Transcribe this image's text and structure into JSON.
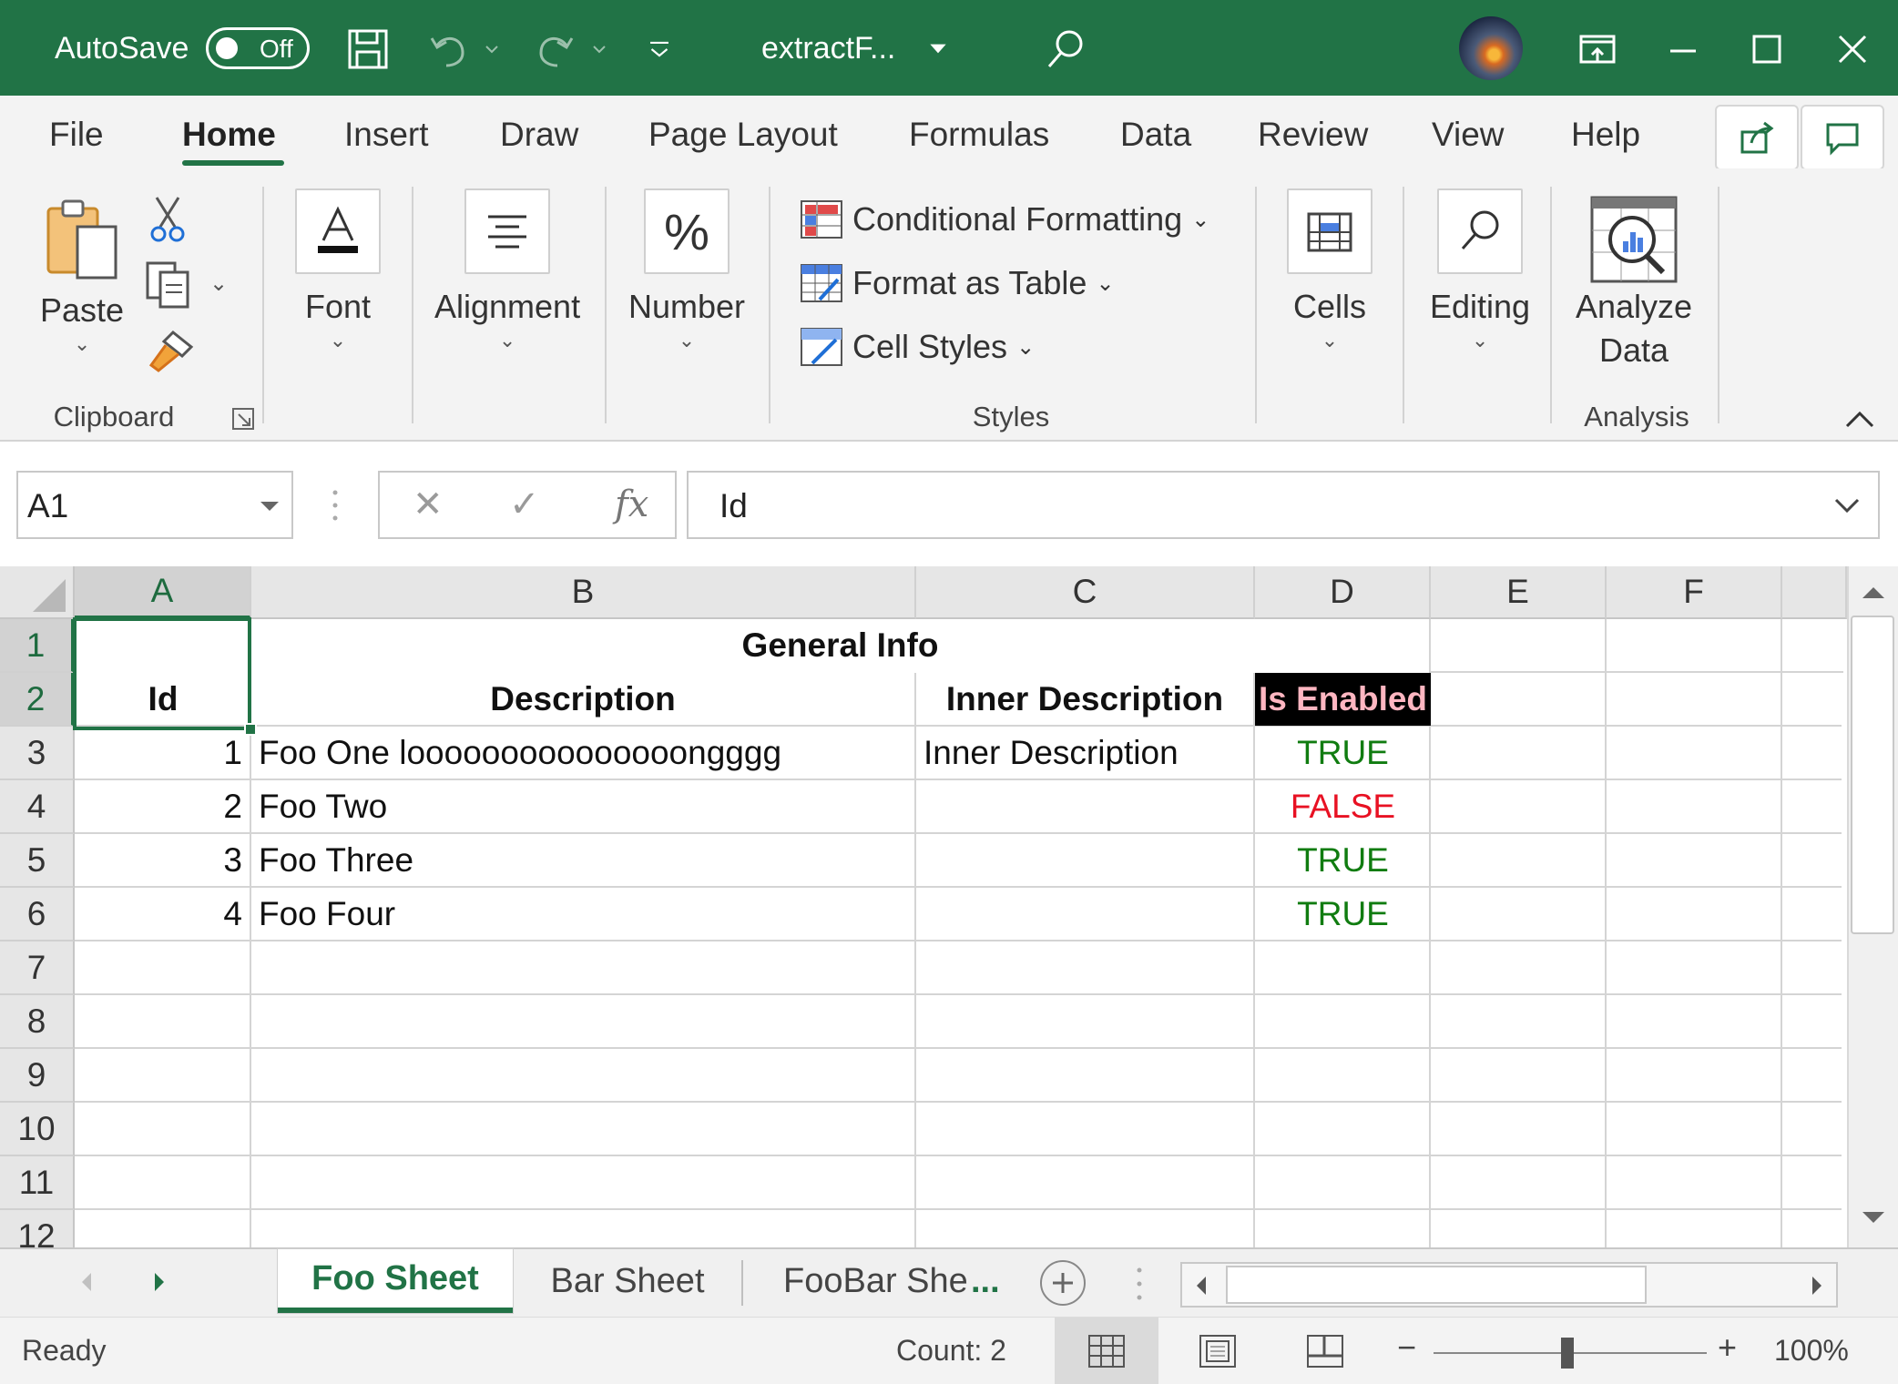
{
  "titlebar": {
    "autosave_label": "AutoSave",
    "autosave_state": "Off",
    "document_title": "extractF...",
    "icons": [
      "save-icon",
      "undo-icon",
      "redo-icon",
      "customize-qat-icon",
      "search-icon",
      "ribbon-display-icon",
      "minimize-icon",
      "maximize-icon",
      "close-icon"
    ]
  },
  "ribbon_tabs": [
    "File",
    "Home",
    "Insert",
    "Draw",
    "Page Layout",
    "Formulas",
    "Data",
    "Review",
    "View",
    "Help"
  ],
  "ribbon_active_tab": "Home",
  "ribbon": {
    "clipboard": {
      "paste": "Paste",
      "group": "Clipboard"
    },
    "font": {
      "label": "Font"
    },
    "alignment": {
      "label": "Alignment"
    },
    "number": {
      "label": "Number",
      "icon_glyph": "%"
    },
    "styles": {
      "conditional": "Conditional Formatting",
      "format_table": "Format as Table",
      "cell_styles": "Cell Styles",
      "group": "Styles"
    },
    "cells": {
      "label": "Cells"
    },
    "editing": {
      "label": "Editing"
    },
    "analysis": {
      "line1": "Analyze",
      "line2": "Data",
      "group": "Analysis"
    }
  },
  "formula_bar": {
    "name_box": "A1",
    "cancel_glyph": "✕",
    "enter_glyph": "✓",
    "fx_glyph": "fx",
    "content": "Id"
  },
  "columns": [
    "A",
    "B",
    "C",
    "D",
    "E",
    "F"
  ],
  "rows": [
    "1",
    "2",
    "3",
    "4",
    "5",
    "6",
    "7",
    "8",
    "9",
    "10",
    "11",
    "12"
  ],
  "sheet": {
    "merged_header": "General Info",
    "headers": {
      "id": "Id",
      "description": "Description",
      "inner": "Inner Description",
      "enabled": "Is Enabled"
    },
    "records": [
      {
        "id": "1",
        "description": "Foo One looooooooooooooongggg",
        "inner": "Inner Description",
        "enabled": "TRUE"
      },
      {
        "id": "2",
        "description": "Foo Two",
        "inner": "",
        "enabled": "FALSE"
      },
      {
        "id": "3",
        "description": "Foo Three",
        "inner": "",
        "enabled": "TRUE"
      },
      {
        "id": "4",
        "description": "Foo Four",
        "inner": "",
        "enabled": "TRUE"
      }
    ]
  },
  "colors": {
    "brand": "#217346",
    "true_text": "#107c10",
    "false_text": "#e81123",
    "enabled_header_bg": "#000000",
    "enabled_header_text": "#ffb6c1"
  },
  "sheet_tabs": [
    "Foo Sheet",
    "Bar Sheet",
    "FooBar She"
  ],
  "active_sheet": "Foo Sheet",
  "sheet_tabs_more": "...",
  "status": {
    "ready": "Ready",
    "count": "Count: 2",
    "zoom": "100%",
    "zoom_minus": "−",
    "zoom_plus": "+"
  }
}
